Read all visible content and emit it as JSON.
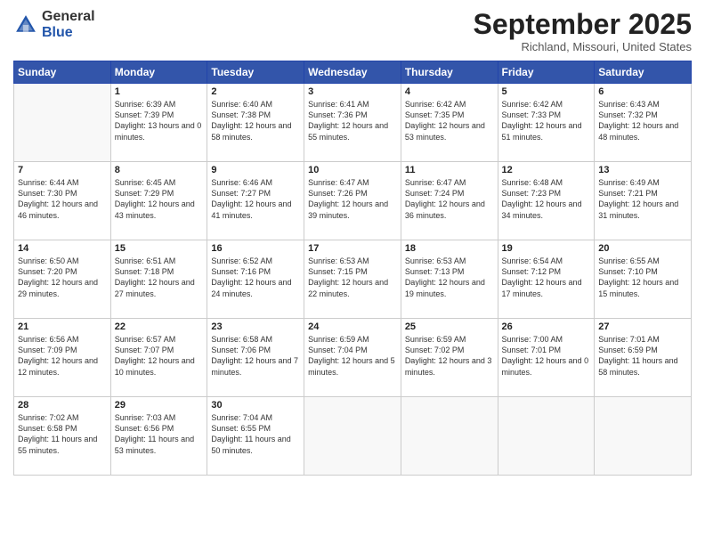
{
  "header": {
    "logo_general": "General",
    "logo_blue": "Blue",
    "month": "September 2025",
    "location": "Richland, Missouri, United States"
  },
  "weekdays": [
    "Sunday",
    "Monday",
    "Tuesday",
    "Wednesday",
    "Thursday",
    "Friday",
    "Saturday"
  ],
  "weeks": [
    [
      {
        "num": "",
        "sunrise": "",
        "sunset": "",
        "daylight": "",
        "empty": true
      },
      {
        "num": "1",
        "sunrise": "Sunrise: 6:39 AM",
        "sunset": "Sunset: 7:39 PM",
        "daylight": "Daylight: 13 hours and 0 minutes."
      },
      {
        "num": "2",
        "sunrise": "Sunrise: 6:40 AM",
        "sunset": "Sunset: 7:38 PM",
        "daylight": "Daylight: 12 hours and 58 minutes."
      },
      {
        "num": "3",
        "sunrise": "Sunrise: 6:41 AM",
        "sunset": "Sunset: 7:36 PM",
        "daylight": "Daylight: 12 hours and 55 minutes."
      },
      {
        "num": "4",
        "sunrise": "Sunrise: 6:42 AM",
        "sunset": "Sunset: 7:35 PM",
        "daylight": "Daylight: 12 hours and 53 minutes."
      },
      {
        "num": "5",
        "sunrise": "Sunrise: 6:42 AM",
        "sunset": "Sunset: 7:33 PM",
        "daylight": "Daylight: 12 hours and 51 minutes."
      },
      {
        "num": "6",
        "sunrise": "Sunrise: 6:43 AM",
        "sunset": "Sunset: 7:32 PM",
        "daylight": "Daylight: 12 hours and 48 minutes."
      }
    ],
    [
      {
        "num": "7",
        "sunrise": "Sunrise: 6:44 AM",
        "sunset": "Sunset: 7:30 PM",
        "daylight": "Daylight: 12 hours and 46 minutes."
      },
      {
        "num": "8",
        "sunrise": "Sunrise: 6:45 AM",
        "sunset": "Sunset: 7:29 PM",
        "daylight": "Daylight: 12 hours and 43 minutes."
      },
      {
        "num": "9",
        "sunrise": "Sunrise: 6:46 AM",
        "sunset": "Sunset: 7:27 PM",
        "daylight": "Daylight: 12 hours and 41 minutes."
      },
      {
        "num": "10",
        "sunrise": "Sunrise: 6:47 AM",
        "sunset": "Sunset: 7:26 PM",
        "daylight": "Daylight: 12 hours and 39 minutes."
      },
      {
        "num": "11",
        "sunrise": "Sunrise: 6:47 AM",
        "sunset": "Sunset: 7:24 PM",
        "daylight": "Daylight: 12 hours and 36 minutes."
      },
      {
        "num": "12",
        "sunrise": "Sunrise: 6:48 AM",
        "sunset": "Sunset: 7:23 PM",
        "daylight": "Daylight: 12 hours and 34 minutes."
      },
      {
        "num": "13",
        "sunrise": "Sunrise: 6:49 AM",
        "sunset": "Sunset: 7:21 PM",
        "daylight": "Daylight: 12 hours and 31 minutes."
      }
    ],
    [
      {
        "num": "14",
        "sunrise": "Sunrise: 6:50 AM",
        "sunset": "Sunset: 7:20 PM",
        "daylight": "Daylight: 12 hours and 29 minutes."
      },
      {
        "num": "15",
        "sunrise": "Sunrise: 6:51 AM",
        "sunset": "Sunset: 7:18 PM",
        "daylight": "Daylight: 12 hours and 27 minutes."
      },
      {
        "num": "16",
        "sunrise": "Sunrise: 6:52 AM",
        "sunset": "Sunset: 7:16 PM",
        "daylight": "Daylight: 12 hours and 24 minutes."
      },
      {
        "num": "17",
        "sunrise": "Sunrise: 6:53 AM",
        "sunset": "Sunset: 7:15 PM",
        "daylight": "Daylight: 12 hours and 22 minutes."
      },
      {
        "num": "18",
        "sunrise": "Sunrise: 6:53 AM",
        "sunset": "Sunset: 7:13 PM",
        "daylight": "Daylight: 12 hours and 19 minutes."
      },
      {
        "num": "19",
        "sunrise": "Sunrise: 6:54 AM",
        "sunset": "Sunset: 7:12 PM",
        "daylight": "Daylight: 12 hours and 17 minutes."
      },
      {
        "num": "20",
        "sunrise": "Sunrise: 6:55 AM",
        "sunset": "Sunset: 7:10 PM",
        "daylight": "Daylight: 12 hours and 15 minutes."
      }
    ],
    [
      {
        "num": "21",
        "sunrise": "Sunrise: 6:56 AM",
        "sunset": "Sunset: 7:09 PM",
        "daylight": "Daylight: 12 hours and 12 minutes."
      },
      {
        "num": "22",
        "sunrise": "Sunrise: 6:57 AM",
        "sunset": "Sunset: 7:07 PM",
        "daylight": "Daylight: 12 hours and 10 minutes."
      },
      {
        "num": "23",
        "sunrise": "Sunrise: 6:58 AM",
        "sunset": "Sunset: 7:06 PM",
        "daylight": "Daylight: 12 hours and 7 minutes."
      },
      {
        "num": "24",
        "sunrise": "Sunrise: 6:59 AM",
        "sunset": "Sunset: 7:04 PM",
        "daylight": "Daylight: 12 hours and 5 minutes."
      },
      {
        "num": "25",
        "sunrise": "Sunrise: 6:59 AM",
        "sunset": "Sunset: 7:02 PM",
        "daylight": "Daylight: 12 hours and 3 minutes."
      },
      {
        "num": "26",
        "sunrise": "Sunrise: 7:00 AM",
        "sunset": "Sunset: 7:01 PM",
        "daylight": "Daylight: 12 hours and 0 minutes."
      },
      {
        "num": "27",
        "sunrise": "Sunrise: 7:01 AM",
        "sunset": "Sunset: 6:59 PM",
        "daylight": "Daylight: 11 hours and 58 minutes."
      }
    ],
    [
      {
        "num": "28",
        "sunrise": "Sunrise: 7:02 AM",
        "sunset": "Sunset: 6:58 PM",
        "daylight": "Daylight: 11 hours and 55 minutes."
      },
      {
        "num": "29",
        "sunrise": "Sunrise: 7:03 AM",
        "sunset": "Sunset: 6:56 PM",
        "daylight": "Daylight: 11 hours and 53 minutes."
      },
      {
        "num": "30",
        "sunrise": "Sunrise: 7:04 AM",
        "sunset": "Sunset: 6:55 PM",
        "daylight": "Daylight: 11 hours and 50 minutes."
      },
      {
        "num": "",
        "sunrise": "",
        "sunset": "",
        "daylight": "",
        "empty": true
      },
      {
        "num": "",
        "sunrise": "",
        "sunset": "",
        "daylight": "",
        "empty": true
      },
      {
        "num": "",
        "sunrise": "",
        "sunset": "",
        "daylight": "",
        "empty": true
      },
      {
        "num": "",
        "sunrise": "",
        "sunset": "",
        "daylight": "",
        "empty": true
      }
    ]
  ]
}
